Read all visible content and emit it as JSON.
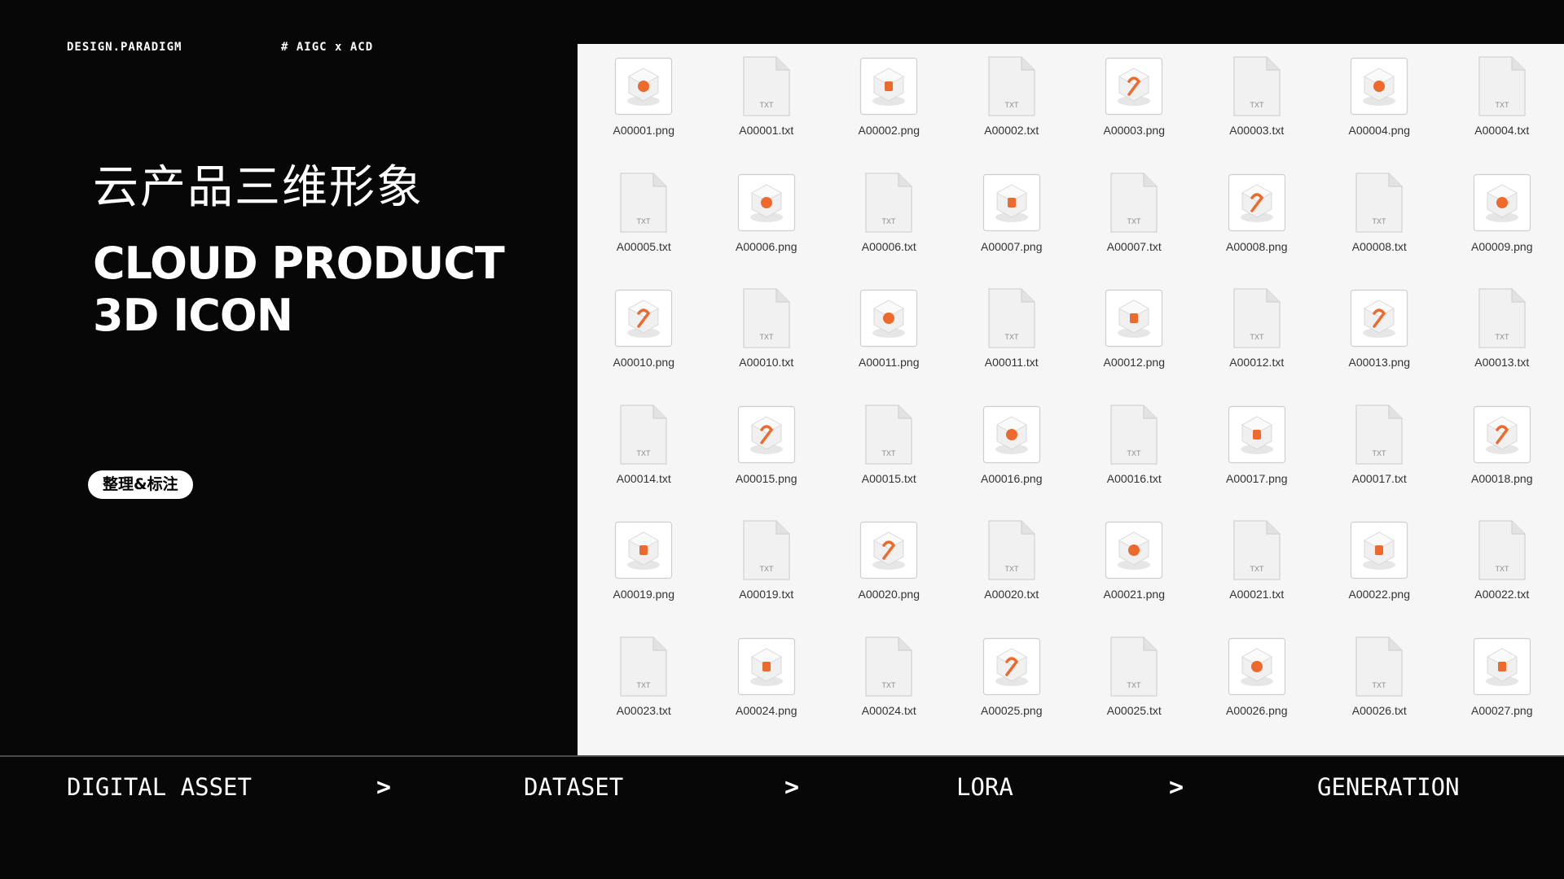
{
  "header": {
    "brand": "DESIGN.PARADIGM",
    "tag": "# AIGC x ACD"
  },
  "hero": {
    "title_cn": "云产品三维形象",
    "title_en_line1": "CLOUD PRODUCT",
    "title_en_line2": "3D ICON",
    "badge": "整理&标注"
  },
  "colors": {
    "accent": "#ee6a2c",
    "background": "#070707",
    "panel": "#f6f6f6"
  },
  "files": [
    {
      "name": "A00001.png",
      "type": "png",
      "icon": "grid-cube-icon"
    },
    {
      "name": "A00001.txt",
      "type": "txt"
    },
    {
      "name": "A00002.png",
      "type": "png",
      "icon": "server-stack-icon"
    },
    {
      "name": "A00002.txt",
      "type": "txt"
    },
    {
      "name": "A00003.png",
      "type": "png",
      "icon": "network-nodes-icon"
    },
    {
      "name": "A00003.txt",
      "type": "txt"
    },
    {
      "name": "A00004.png",
      "type": "png",
      "icon": "wave-cube-icon"
    },
    {
      "name": "A00004.txt",
      "type": "txt"
    },
    {
      "name": "A00005.txt",
      "type": "txt"
    },
    {
      "name": "A00006.png",
      "type": "png",
      "icon": "lock-icon"
    },
    {
      "name": "A00006.txt",
      "type": "txt"
    },
    {
      "name": "A00007.png",
      "type": "png",
      "icon": "disc-icon"
    },
    {
      "name": "A00007.txt",
      "type": "txt"
    },
    {
      "name": "A00008.png",
      "type": "png",
      "icon": "camera-icon"
    },
    {
      "name": "A00008.txt",
      "type": "txt"
    },
    {
      "name": "A00009.png",
      "type": "png",
      "icon": "triangle-nodes-icon"
    },
    {
      "name": "A00010.png",
      "type": "png",
      "icon": "platform-icon"
    },
    {
      "name": "A00010.txt",
      "type": "txt"
    },
    {
      "name": "A00011.png",
      "type": "png",
      "icon": "cloud-stack-icon"
    },
    {
      "name": "A00011.txt",
      "type": "txt"
    },
    {
      "name": "A00012.png",
      "type": "png",
      "icon": "tree-cube-icon"
    },
    {
      "name": "A00012.txt",
      "type": "txt"
    },
    {
      "name": "A00013.png",
      "type": "png",
      "icon": "pin-platform-icon"
    },
    {
      "name": "A00013.txt",
      "type": "txt"
    },
    {
      "name": "A00014.txt",
      "type": "txt"
    },
    {
      "name": "A00015.png",
      "type": "png",
      "icon": "bot-icon"
    },
    {
      "name": "A00015.txt",
      "type": "txt"
    },
    {
      "name": "A00016.png",
      "type": "png",
      "icon": "shield-icon"
    },
    {
      "name": "A00016.txt",
      "type": "txt"
    },
    {
      "name": "A00017.png",
      "type": "png",
      "icon": "rotate-icon"
    },
    {
      "name": "A00017.txt",
      "type": "txt"
    },
    {
      "name": "A00018.png",
      "type": "png",
      "icon": "blocks-icon"
    },
    {
      "name": "A00019.png",
      "type": "png",
      "icon": "layers-icon"
    },
    {
      "name": "A00019.txt",
      "type": "txt"
    },
    {
      "name": "A00020.png",
      "type": "png",
      "icon": "hub-icon"
    },
    {
      "name": "A00020.txt",
      "type": "txt"
    },
    {
      "name": "A00021.png",
      "type": "png",
      "icon": "gear-box-icon"
    },
    {
      "name": "A00021.txt",
      "type": "txt"
    },
    {
      "name": "A00022.png",
      "type": "png",
      "icon": "spiral-icon"
    },
    {
      "name": "A00022.txt",
      "type": "txt"
    },
    {
      "name": "A00023.txt",
      "type": "txt"
    },
    {
      "name": "A00024.png",
      "type": "png",
      "icon": "hex-box-icon"
    },
    {
      "name": "A00024.txt",
      "type": "txt"
    },
    {
      "name": "A00025.png",
      "type": "png",
      "icon": "small-cube-icon"
    },
    {
      "name": "A00025.txt",
      "type": "txt"
    },
    {
      "name": "A00026.png",
      "type": "png",
      "icon": "swirl-platform-icon"
    },
    {
      "name": "A00026.txt",
      "type": "txt"
    },
    {
      "name": "A00027.png",
      "type": "png",
      "icon": "panel-cube-icon"
    }
  ],
  "txt_label": "TXT",
  "pipeline": {
    "steps": [
      "DIGITAL ASSET",
      "DATASET",
      "LORA",
      "GENERATION"
    ],
    "arrow": ">"
  }
}
